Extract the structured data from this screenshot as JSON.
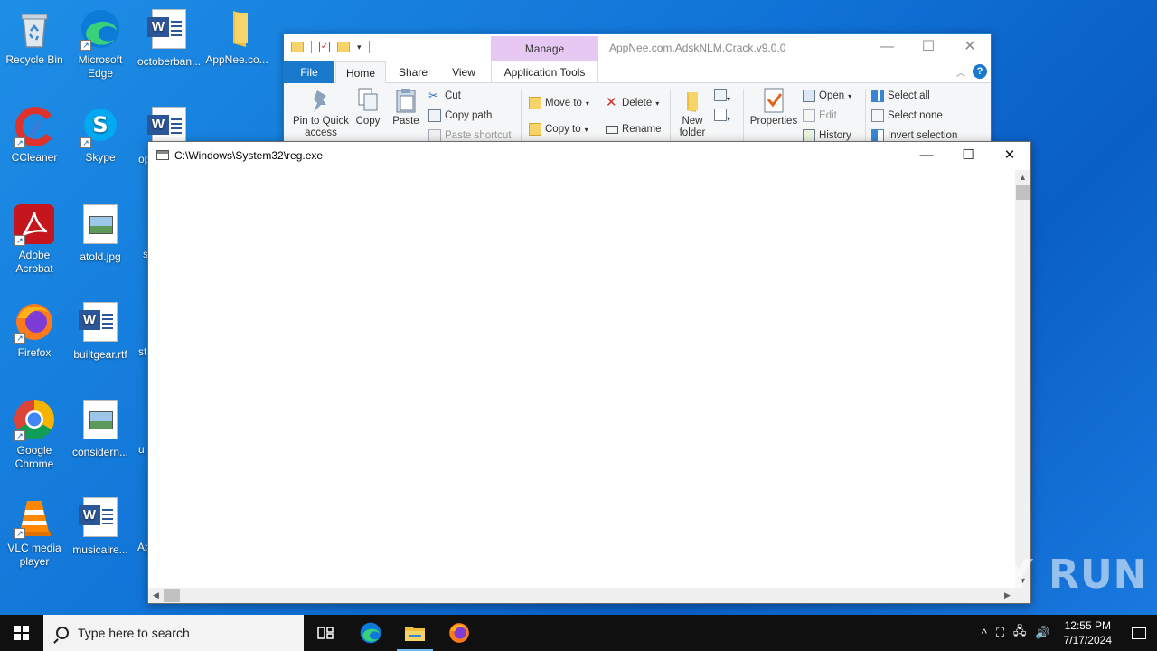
{
  "desktop": {
    "icons": [
      {
        "label": "Recycle Bin",
        "type": "recycle"
      },
      {
        "label": "Microsoft Edge",
        "type": "edge"
      },
      {
        "label": "octoberban...",
        "type": "word"
      },
      {
        "label": "AppNee.co...",
        "type": "folder"
      },
      {
        "label": "CCleaner",
        "type": "ccleaner"
      },
      {
        "label": "Skype",
        "type": "skype"
      },
      {
        "label": "op",
        "type": "word"
      },
      {
        "label": "Adobe Acrobat",
        "type": "acrobat"
      },
      {
        "label": "atold.jpg",
        "type": "image"
      },
      {
        "label": "s",
        "type": "partial"
      },
      {
        "label": "Firefox",
        "type": "firefox"
      },
      {
        "label": "builtgear.rtf",
        "type": "word"
      },
      {
        "label": "st",
        "type": "partial"
      },
      {
        "label": "Google Chrome",
        "type": "chrome"
      },
      {
        "label": "considern...",
        "type": "image"
      },
      {
        "label": "u",
        "type": "partial"
      },
      {
        "label": "VLC media player",
        "type": "vlc"
      },
      {
        "label": "musicalre...",
        "type": "word"
      },
      {
        "label": "Ap",
        "type": "partial"
      }
    ]
  },
  "explorer": {
    "title": "AppNee.com.AdskNLM.Crack.v9.0.0",
    "manage_label": "Manage",
    "tabs": {
      "file": "File",
      "home": "Home",
      "share": "Share",
      "view": "View",
      "app_tools": "Application Tools"
    },
    "ribbon": {
      "pin": "Pin to Quick access",
      "copy": "Copy",
      "paste": "Paste",
      "cut": "Cut",
      "copy_path": "Copy path",
      "paste_shortcut": "Paste shortcut",
      "move_to": "Move to",
      "copy_to": "Copy to",
      "delete": "Delete",
      "rename": "Rename",
      "new_folder": "New folder",
      "properties": "Properties",
      "open": "Open",
      "edit": "Edit",
      "history": "History",
      "select_all": "Select all",
      "select_none": "Select none",
      "invert_selection": "Invert selection"
    },
    "controls": {
      "minimize": "—",
      "maximize": "☐",
      "close": "✕"
    }
  },
  "regwin": {
    "title": "C:\\Windows\\System32\\reg.exe",
    "controls": {
      "minimize": "—",
      "maximize": "☐",
      "close": "✕"
    }
  },
  "watermark": "ANY RUN",
  "taskbar": {
    "search_placeholder": "Type here to search",
    "time": "12:55 PM",
    "date": "7/17/2024",
    "tray_caret": "^"
  },
  "colors": {
    "desktop": "#1072d6",
    "accent": "#1979ca",
    "manage_tab": "#e6c8f3",
    "taskbar": "#101010"
  }
}
